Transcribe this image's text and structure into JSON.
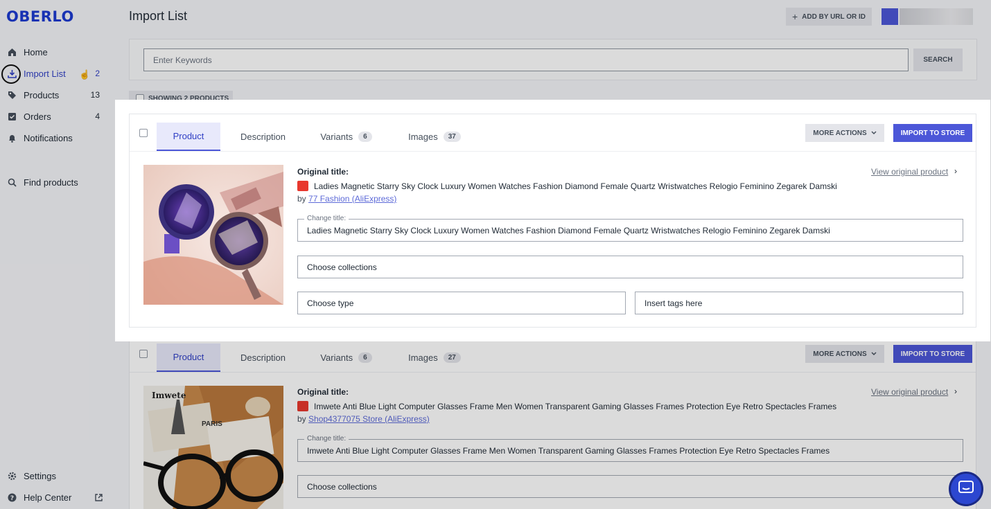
{
  "app": {
    "logo": "OBERLO",
    "page_title": "Import List"
  },
  "header": {
    "add_by_url_label": "ADD BY URL OR ID"
  },
  "sidebar": {
    "items": [
      {
        "label": "Home",
        "icon": "home-icon",
        "count": ""
      },
      {
        "label": "Import List",
        "icon": "import-icon",
        "count": "2"
      },
      {
        "label": "Products",
        "icon": "tag-icon",
        "count": "13"
      },
      {
        "label": "Orders",
        "icon": "orders-icon",
        "count": "4"
      },
      {
        "label": "Notifications",
        "icon": "bell-icon",
        "count": ""
      },
      {
        "label": "Find products",
        "icon": "search-icon",
        "count": ""
      }
    ],
    "footer": [
      {
        "label": "Settings",
        "icon": "gear-icon"
      },
      {
        "label": "Help Center",
        "icon": "help-icon"
      }
    ]
  },
  "search": {
    "placeholder": "Enter Keywords",
    "button_label": "SEARCH"
  },
  "showing_label": "SHOWING 2 PRODUCTS",
  "products": [
    {
      "tabs": {
        "product": "Product",
        "description": "Description",
        "variants": "Variants",
        "variants_count": "6",
        "images": "Images",
        "images_count": "37"
      },
      "more_actions": "MORE ACTIONS",
      "import_label": "IMPORT TO STORE",
      "original_title_label": "Original title:",
      "original_title": "Ladies Magnetic Starry Sky Clock Luxury Women Watches Fashion Diamond Female Quartz Wristwatches Relogio Feminino Zegarek Damski",
      "by": "by",
      "store": "77 Fashion (AliExpress)",
      "view_original": "View original product",
      "change_title_label": "Change title:",
      "change_title_value": "Ladies Magnetic Starry Sky Clock Luxury Women Watches Fashion Diamond Female Quartz Wristwatches Relogio Feminino Zegarek Damski",
      "collections_placeholder": "Choose collections",
      "type_placeholder": "Choose type",
      "tags_placeholder": "Insert tags here"
    },
    {
      "tabs": {
        "product": "Product",
        "description": "Description",
        "variants": "Variants",
        "variants_count": "6",
        "images": "Images",
        "images_count": "27"
      },
      "more_actions": "MORE ACTIONS",
      "import_label": "IMPORT TO STORE",
      "original_title_label": "Original title:",
      "original_title": "Imwete Anti Blue Light Computer Glasses Frame Men Women Transparent Gaming Glasses Frames Protection Eye Retro Spectacles Frames",
      "by": "by",
      "store": "Shop4377075 Store (AliExpress)",
      "view_original": "View original product",
      "change_title_label": "Change title:",
      "change_title_value": "Imwete Anti Blue Light Computer Glasses Frame Men Women Transparent Gaming Glasses Frames Protection Eye Retro Spectacles Frames",
      "collections_placeholder": "Choose collections",
      "thumb_brand": "Imwete",
      "thumb_city": "PARIS"
    }
  ],
  "colors": {
    "brand": "#1d3bd1",
    "accent": "#4c57d8",
    "aliexpress": "#e8382e"
  }
}
